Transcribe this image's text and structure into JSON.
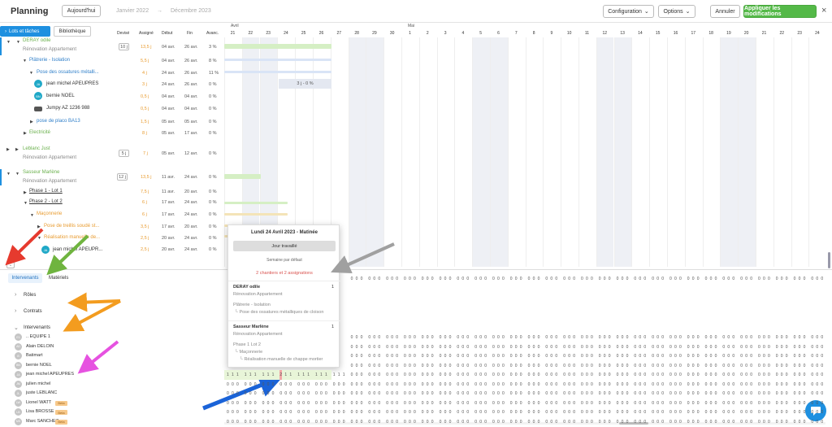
{
  "header": {
    "title": "Planning",
    "today_label": "Aujourd'hui",
    "date_from": "Janvier 2022",
    "date_arrow": "→",
    "date_to": "Décembre 2023",
    "configuration_label": "Configuration",
    "options_label": "Options",
    "cancel_label": "Annuler",
    "apply_label": "Appliquer les modifications",
    "close": "×"
  },
  "left_tabs": {
    "active": "Lots et tâches",
    "other": "Bibliothèque"
  },
  "columns": {
    "devis": "Devisé",
    "assigne": "Assigné",
    "debut": "Début",
    "fin": "Fin",
    "avanc": "Avanc."
  },
  "tree": [
    {
      "label": "DERAY odile",
      "sub": "Rénovation Appartement",
      "devis": "10 j",
      "assigne": "13,5 j",
      "debut": "04 avr.",
      "fin": "26 avr.",
      "avanc": "3 %"
    },
    {
      "label": "Plâtrerie - Isolation",
      "assigne": "5,5 j",
      "debut": "04 avr.",
      "fin": "26 avr.",
      "avanc": "8 %"
    },
    {
      "label": "Pose des ossatures métalli...",
      "assigne": "4 j",
      "debut": "24 avr.",
      "fin": "26 avr.",
      "avanc": "11 %"
    },
    {
      "label": "jean michel APEUPRES",
      "assigne": "3 j",
      "debut": "24 avr.",
      "fin": "26 avr.",
      "avanc": "0 %"
    },
    {
      "label": "bernie NOEL",
      "assigne": "0,5 j",
      "debut": "04 avr.",
      "fin": "04 avr.",
      "avanc": "0 %"
    },
    {
      "label": "Jumpy AZ 1236 988",
      "assigne": "0,5 j",
      "debut": "04 avr.",
      "fin": "04 avr.",
      "avanc": "0 %"
    },
    {
      "label": "pose de placo BA13",
      "assigne": "1,5 j",
      "debut": "05 avr.",
      "fin": "05 avr.",
      "avanc": "0 %"
    },
    {
      "label": "Electricité",
      "assigne": "8 j",
      "debut": "05 avr.",
      "fin": "17 avr.",
      "avanc": "0 %"
    },
    {
      "label": "Leblanc Just",
      "sub": "Rénovation Appartement",
      "devis": "5 j",
      "assigne": "7 j",
      "debut": "05 avr.",
      "fin": "12 avr.",
      "avanc": "0 %"
    },
    {
      "label": "Sasseur Marlène",
      "sub": "Rénovation Appartement",
      "devis": "12 j",
      "assigne": "13,5 j",
      "debut": "11 avr.",
      "fin": "24 avr.",
      "avanc": "0 %"
    },
    {
      "label": "Phase 1 - Lot 1",
      "assigne": "7,5 j",
      "debut": "11 avr.",
      "fin": "20 avr.",
      "avanc": "0 %"
    },
    {
      "label": "Phase 2 - Lot 2",
      "assigne": "6 j",
      "debut": "17 avr.",
      "fin": "24 avr.",
      "avanc": "0 %"
    },
    {
      "label": "Maçonnerie",
      "assigne": "6 j",
      "debut": "17 avr.",
      "fin": "24 avr.",
      "avanc": "0 %"
    },
    {
      "label": "Pose de treillis soudé st...",
      "assigne": "3,5 j",
      "debut": "17 avr.",
      "fin": "20 avr.",
      "avanc": "0 %"
    },
    {
      "label": "Réalisation manuelle de...",
      "assigne": "2,5 j",
      "debut": "20 avr.",
      "fin": "24 avr.",
      "avanc": "0 %"
    },
    {
      "label": "jean michel APEUPR...",
      "assigne": "2,5 j",
      "debut": "20 avr.",
      "fin": "24 avr.",
      "avanc": "0 %"
    }
  ],
  "gantt": {
    "month_april": "Avril",
    "month_may": "Mai",
    "days": [
      "21",
      "22",
      "23",
      "24",
      "25",
      "26",
      "27",
      "28",
      "29",
      "30",
      "1",
      "2",
      "3",
      "4",
      "5",
      "6",
      "7",
      "8",
      "9",
      "10",
      "11",
      "12",
      "13",
      "14",
      "15",
      "16",
      "17",
      "18",
      "19",
      "20",
      "21",
      "22",
      "23",
      "24"
    ],
    "bar_label": "3 j - 0 %"
  },
  "bottom_tabs": {
    "active": "Intervenants",
    "other": "Matériels"
  },
  "sections": {
    "roles": "Rôles",
    "contrats": "Contrats",
    "intervenants": "Intervenants"
  },
  "people": [
    {
      "name": ".. EQUIPE 1",
      "initials": "E1",
      "badge": ""
    },
    {
      "name": "Alain DELOIN",
      "initials": "AD",
      "badge": ""
    },
    {
      "name": "Batimart",
      "initials": "B",
      "badge": ""
    },
    {
      "name": "bernie NOEL",
      "initials": "BN",
      "badge": ""
    },
    {
      "name": "jean michel APEUPRES",
      "initials": "JA",
      "badge": ""
    },
    {
      "name": "julien michel",
      "initials": "JM",
      "badge": ""
    },
    {
      "name": "juste LEBLANC",
      "initials": "JL",
      "badge": ""
    },
    {
      "name": "Lionel WATT",
      "initials": "LW",
      "badge": "Beta"
    },
    {
      "name": "Lisa BROSSE",
      "initials": "LB",
      "badge": "Beta"
    },
    {
      "name": "Marc SANCHEZ",
      "initials": "MS",
      "badge": "Beta"
    }
  ],
  "popup": {
    "title": "Lundi 24 Avril 2023 - Matinée",
    "button": "Jour travaillé",
    "week": "Semaine par défaut",
    "summary": "2 chantiers et 2 assignations",
    "client1": "DERAY odile",
    "client1_count": "1",
    "client1_project": "Rénovation Appartement",
    "client1_lot": "Plâtrerie - Isolation",
    "client1_task": "Pose des ossatures métalliques de cloison",
    "client2": "Sasseur Marlène",
    "client2_count": "1",
    "client2_project": "Rénovation Appartement",
    "client2_lot": "Phase 1 Lot 2",
    "client2_sub": "Maçonnerie",
    "client2_task": "Réalisation manuelle de chappe mortier"
  },
  "grid_values": {
    "zero": "0",
    "one": "1",
    "two": "2"
  }
}
